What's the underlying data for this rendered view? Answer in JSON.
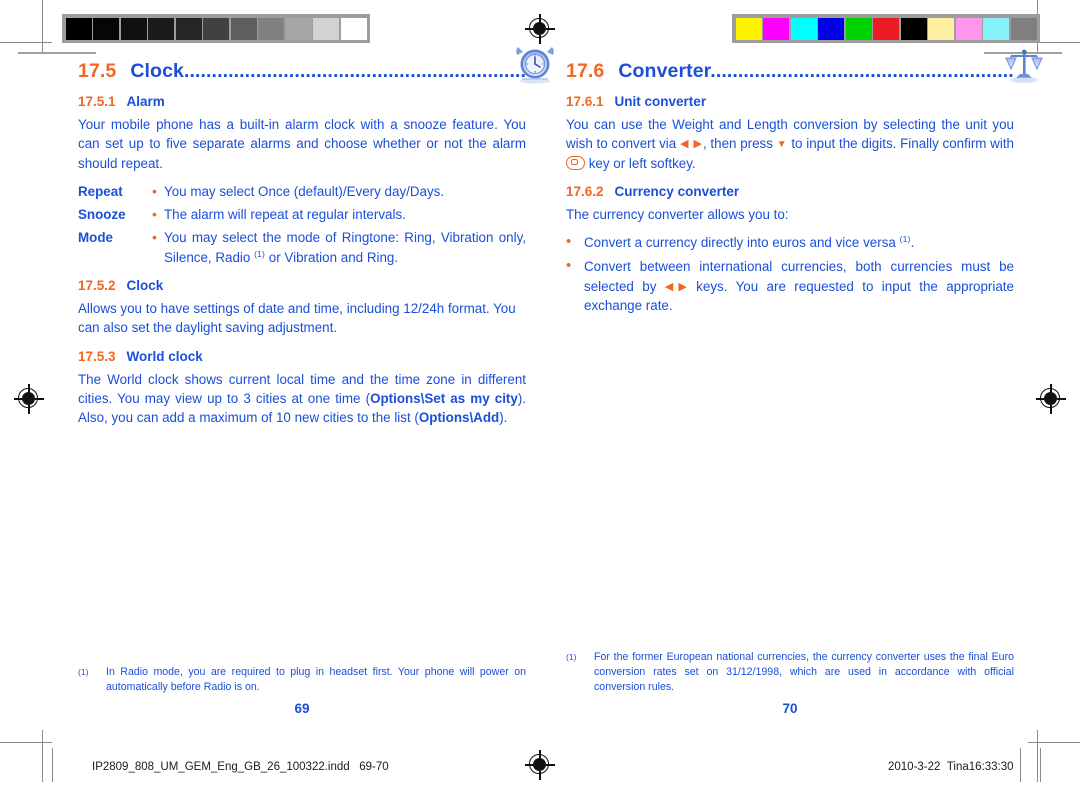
{
  "document": {
    "type": "print-proof-spread",
    "colors": {
      "heading_number": "#F26522",
      "heading_text": "#1B4FD8",
      "body_text": "#1B4FD8",
      "bullet": "#F26522"
    }
  },
  "calibration": {
    "grayscale_bar": {
      "name": "grayscale-step-wedge",
      "swatches": [
        "#000000",
        "#060606",
        "#101010",
        "#1b1b1b",
        "#252525",
        "#414141",
        "#5e5e5e",
        "#818181",
        "#a6a6a6",
        "#d2d2d2",
        "#ffffff"
      ]
    },
    "color_bar": {
      "name": "process-color-bar",
      "swatches": [
        "#FFF200",
        "#FF00FF",
        "#00FFFF",
        "#0000E8",
        "#00D200",
        "#ED1C24",
        "#000000",
        "#FCF0A0",
        "#FF95EC",
        "#86F3FA",
        "#7F7F7F"
      ]
    }
  },
  "left_page": {
    "heading": {
      "number": "17.5",
      "title": "Clock",
      "leader": "..................................................................",
      "icon": "alarm-clock-icon"
    },
    "sections": [
      {
        "number": "17.5.1",
        "title": "Alarm",
        "paragraphs": [
          "Your mobile phone has a built-in alarm clock with a snooze feature. You can set up to five separate alarms and choose whether or not the alarm should repeat."
        ],
        "definitions": [
          {
            "term": "Repeat",
            "bullet": "•",
            "description": "You may select Once (default)/Every day/Days."
          },
          {
            "term": "Snooze",
            "bullet": "•",
            "description": "The alarm will repeat at regular intervals."
          },
          {
            "term": "Mode",
            "bullet": "•",
            "description_pre": "You may select the mode of Ringtone: Ring, Vibration only, Silence, Radio ",
            "footnote_mark": "(1)",
            "description_post": " or Vibration and Ring."
          }
        ]
      },
      {
        "number": "17.5.2",
        "title": "Clock",
        "paragraphs": [
          "Allows you to have settings of date and time, including 12/24h format. You can also set the daylight saving adjustment."
        ]
      },
      {
        "number": "17.5.3",
        "title": "World clock",
        "rich_paragraph": {
          "part1": "The World clock shows current local time and the time zone in different cities. You may view up to 3 cities at one time (",
          "bold1": "Options\\Set as my city",
          "part2": "). Also, you can add a maximum of 10 new cities to the list (",
          "bold2": "Options\\Add",
          "part3": ")."
        }
      }
    ],
    "footnote": {
      "mark": "(1)",
      "text": "In Radio mode, you are required to plug in headset first. Your phone will power on automatically before Radio is on."
    },
    "folio": "69"
  },
  "right_page": {
    "heading": {
      "number": "17.6",
      "title": "Converter",
      "leader": ".........................................................",
      "icon": "balance-scales-icon"
    },
    "sections": [
      {
        "number": "17.6.1",
        "title": "Unit converter",
        "rich_paragraph": {
          "part1": "You can use the Weight and Length conversion by selecting the unit you wish to convert via ",
          "glyph_leftright": "◀ ▶",
          "part2": ", then press ",
          "glyph_down": "▼",
          "part3": " to input the digits. Finally confirm with ",
          "glyph_ok": "ok-key-icon",
          "part4": " key or left softkey."
        }
      },
      {
        "number": "17.6.2",
        "title": "Currency converter",
        "paragraphs": [
          "The currency converter allows you to:"
        ],
        "bullets": [
          {
            "bullet": "•",
            "text_pre": "Convert a currency directly into euros and vice versa ",
            "footnote_mark": "(1)",
            "text_post": "."
          },
          {
            "bullet": "•",
            "text_pre": "Convert between international currencies, both currencies must be selected by ",
            "glyph_leftright": "◀ ▶",
            "text_post": " keys. You are requested to input the appropriate exchange rate."
          }
        ]
      }
    ],
    "footnote": {
      "mark": "(1)",
      "text": "For the former European national currencies, the currency converter uses the final Euro conversion rates set on 31/12/1998, which are used in accordance with official conversion rules."
    },
    "folio": "70"
  },
  "production_slug": {
    "filename": "IP2809_808_UM_GEM_Eng_GB_26_100322.indd",
    "pages": "69-70",
    "date": "2010-3-22",
    "operator_time": "Tina16:33:30"
  }
}
